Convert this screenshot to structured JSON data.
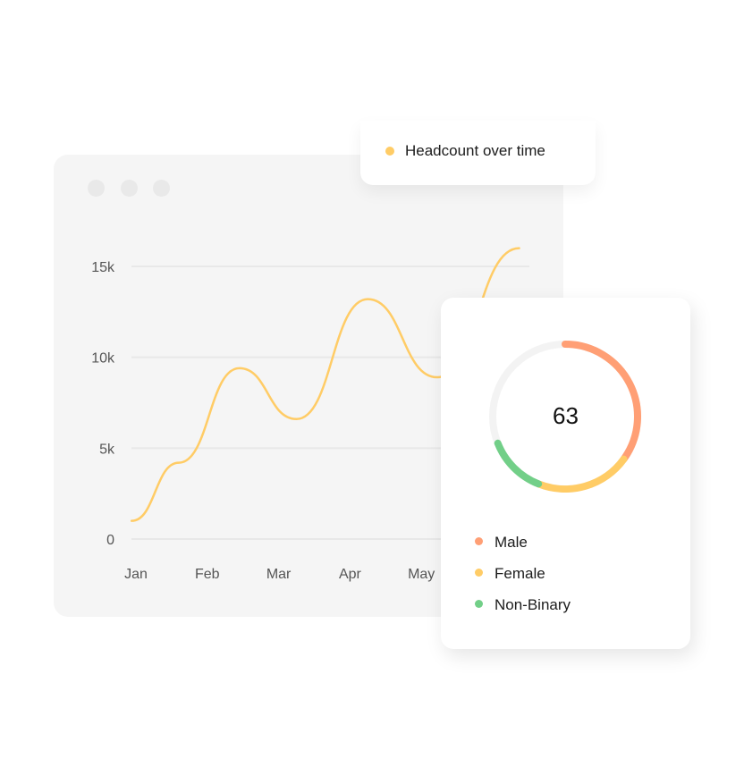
{
  "window_dots": 3,
  "legend": {
    "label": "Headcount over time",
    "color": "#ffcc66"
  },
  "chart_data": [
    {
      "type": "line",
      "title": "Headcount over time",
      "categories": [
        "Jan",
        "Feb",
        "Mar",
        "Apr",
        "May"
      ],
      "y_ticks": [
        "0",
        "5k",
        "10k",
        "15k"
      ],
      "y_tick_values": [
        0,
        5000,
        10000,
        15000
      ],
      "ylim": [
        0,
        15000
      ],
      "grid": true,
      "series": [
        {
          "name": "Headcount over time",
          "color": "#ffcc66",
          "x_month_index": [
            -0.06,
            0.6,
            1.45,
            2.25,
            3.25,
            4.22,
            5.37
          ],
          "values": [
            1000,
            4200,
            9400,
            6600,
            13200,
            8900,
            16000
          ]
        }
      ]
    },
    {
      "type": "pie",
      "variant": "donut",
      "center_label": "63",
      "slices": [
        {
          "name": "Male",
          "fraction": 0.35,
          "color": "#ff9f75"
        },
        {
          "name": "Female",
          "fraction": 0.21,
          "color": "#ffcc66"
        },
        {
          "name": "Non-Binary",
          "fraction": 0.13,
          "color": "#72cf88"
        }
      ],
      "track_color": "#f3f3f3",
      "legend_position": "bottom"
    }
  ]
}
